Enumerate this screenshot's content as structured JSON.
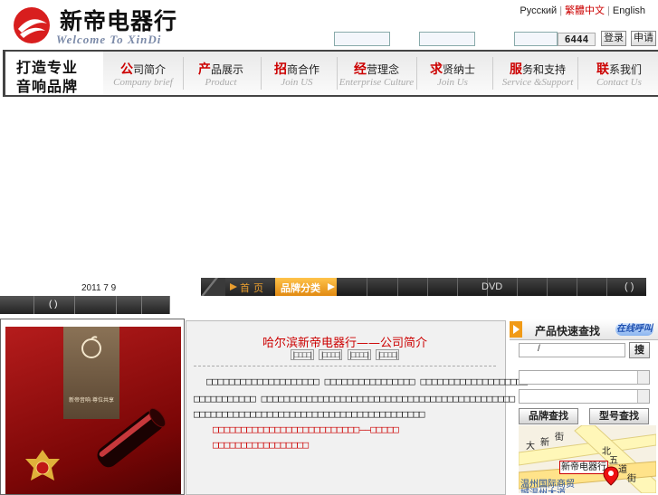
{
  "header": {
    "logo_cn": "新帝电器行",
    "logo_en": "Welcome To XinDi",
    "lang": [
      "Русский",
      "繁體中文",
      "English"
    ],
    "code": "6444",
    "login_btn": "登录",
    "register_btn": "申请"
  },
  "slogan": {
    "line1": "打造专业",
    "line2": "音响品牌"
  },
  "nav": [
    {
      "first": "公",
      "rest": "司简介",
      "en": "Company brief"
    },
    {
      "first": "产",
      "rest": "品展示",
      "en": "Product"
    },
    {
      "first": "招",
      "rest": "商合作",
      "en": "Join US"
    },
    {
      "first": "经",
      "rest": "营理念",
      "en": "Enterprise Culture"
    },
    {
      "first": "求",
      "rest": "贤纳士",
      "en": "Join Us"
    },
    {
      "first": "服",
      "rest": "务和支持",
      "en": "Service &Support"
    },
    {
      "first": "联",
      "rest": "系我们",
      "en": "Contact Us"
    }
  ],
  "date_text": "2011 7 9",
  "left_bar_text": "( )",
  "top_bar": {
    "home": "首页",
    "brand": "品牌分类",
    "dvd": "DVD",
    "paren": "( )"
  },
  "center": {
    "title": "哈尔滨新帝电器行——公司简介",
    "tabs": [
      "|□□□□|",
      "|□□□□|",
      "|□□□□|",
      "|□□□□|"
    ],
    "p1": "□□□□□□□□□□□□□□□□□□□□ □□□□□□□□□□□□□□□□ □□□□□□□□□□□□□□□□□□□",
    "p2": "□□□□□□□□□□□ □□□□□□□□□□□□□□□□□□□□□□□□□□□□□□□□□□□□□□□□□□□□□",
    "p3": "□□□□□□□□□□□□□□□□□□□□□□□□□□□□□□□□□□□□□□□□□",
    "red1": "□□□□□□□□□□□□□□□□□□□□□□□□□□——□□□□□",
    "red2": "□□□□□□□□□□□□□□□□□"
  },
  "sidebar": {
    "title": "产品快速查找",
    "online": "在线呼叫",
    "search_value": "/",
    "search_btn": "搜",
    "brand_btn": "品牌查找",
    "model_btn": "型号查找"
  },
  "map": {
    "road1": [
      "大",
      "新",
      "街"
    ],
    "road2": [
      "北",
      "五",
      "道",
      "街"
    ],
    "store_label": "新帝电器行",
    "bottom1": "温州国际商贸",
    "bottom2": "城温州大道"
  },
  "product_caption": "新帝音响·尊位共享",
  "colors": {
    "accent_red": "#cc0000",
    "orange": "#f19a16",
    "dark_bar": "#222222"
  }
}
